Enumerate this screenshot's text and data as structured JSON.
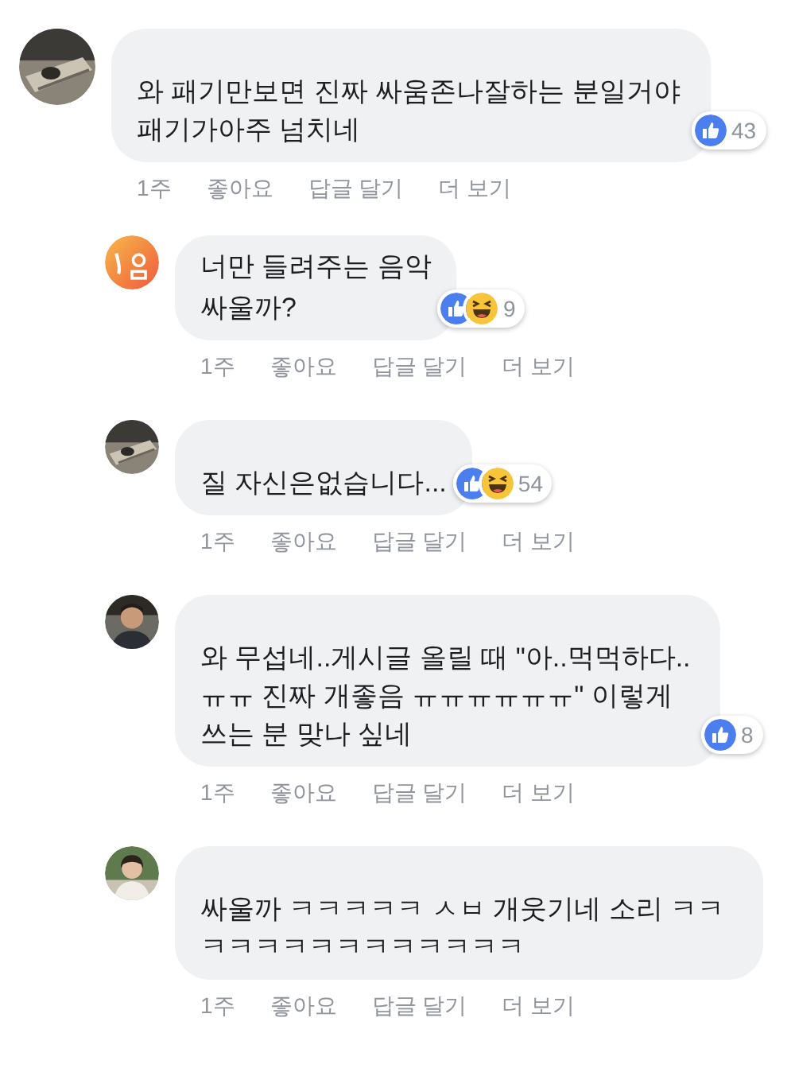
{
  "comments": [
    {
      "kind": "comment",
      "avatar": {
        "kind": "picture"
      },
      "text": "와 패기만보면 진짜 싸움존나잘하는 분일거야 패기가아주 넘치네",
      "reactions": [
        {
          "kind": "like"
        }
      ],
      "reaction_count": "43",
      "actions": [
        "1주",
        "좋아요",
        "답글 달기",
        "더 보기"
      ]
    },
    {
      "kind": "reply",
      "avatar": {
        "kind": "picture"
      },
      "author": "너만 들려주는 음악",
      "text": "싸울까?",
      "reactions": [
        {
          "kind": "like"
        },
        {
          "kind": "haha"
        }
      ],
      "reaction_count": "9",
      "actions": [
        "1주",
        "좋아요",
        "답글 달기",
        "더 보기"
      ]
    },
    {
      "kind": "reply",
      "avatar": {
        "kind": "picture"
      },
      "text": "질 자신은없습니다...",
      "reactions": [
        {
          "kind": "like"
        },
        {
          "kind": "haha"
        }
      ],
      "reaction_count": "54",
      "actions": [
        "1주",
        "좋아요",
        "답글 달기",
        "더 보기"
      ]
    },
    {
      "kind": "reply",
      "avatar": {
        "kind": "picture"
      },
      "text": "와 무섭네..게시글 올릴 때 \"아..먹먹하다..ㅠㅠ 진짜 개좋음 ㅠㅠㅠㅠㅠㅠ\" 이렇게 쓰는 분 맞나 싶네",
      "reactions": [
        {
          "kind": "like"
        }
      ],
      "reaction_count": "8",
      "actions": [
        "1주",
        "좋아요",
        "답글 달기",
        "더 보기"
      ]
    },
    {
      "kind": "reply",
      "avatar": {
        "kind": "picture"
      },
      "text": "싸울까 ㅋㅋㅋㅋㅋ ㅅㅂ 개웃기네 소리 ㅋㅋㅋㅋㅋㅋㅋㅋㅋㅋㅋㅋㅋㅋ",
      "actions": [
        "1주",
        "좋아요",
        "답글 달기",
        "더 보기"
      ]
    }
  ]
}
